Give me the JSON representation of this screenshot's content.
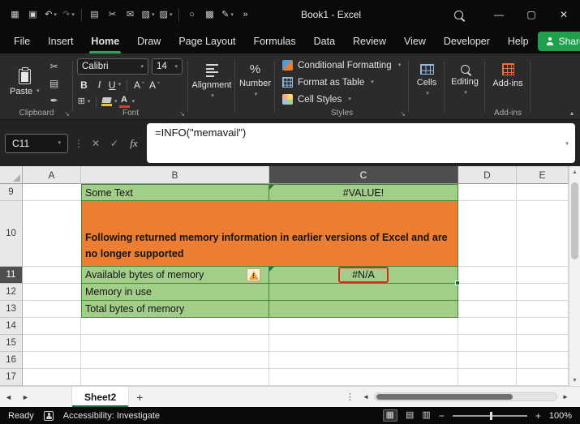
{
  "icons": {
    "customize": "▦",
    "save": "▣",
    "undo": "↶",
    "redo": "↷",
    "book": "▤",
    "cut": "✂",
    "mail": "✉",
    "table": "▧",
    "paint": "▨",
    "touch": "○",
    "camera": "▩",
    "draw": "✎",
    "more": "»",
    "chevron_down": "▾",
    "chevron_up": "▴",
    "minimize": "—",
    "maximize": "▢",
    "close": "✕",
    "vdots": "⋮",
    "cancel": "✕",
    "check": "✓",
    "copy": "▤",
    "format_painter": "✒",
    "borders": "⊞",
    "percent": "%",
    "caret_up": "ˆ",
    "caret_down": "ˇ",
    "launcher": "↘",
    "scroll_up": "▲",
    "scroll_down": "▼",
    "prev": "◄",
    "next": "►",
    "plus": "+",
    "minus": "−",
    "view_normal": "▦",
    "view_layout": "▤",
    "view_break": "▥"
  },
  "titlebar": {
    "title": "Book1 - Excel"
  },
  "ribbon_tabs": [
    "File",
    "Insert",
    "Home",
    "Draw",
    "Page Layout",
    "Formulas",
    "Data",
    "Review",
    "View",
    "Developer",
    "Help"
  ],
  "share": {
    "label": "Share"
  },
  "ribbon": {
    "clipboard": {
      "group_label": "Clipboard",
      "paste_label": "Paste"
    },
    "font": {
      "group_label": "Font",
      "family": "Calibri",
      "size": "14",
      "bold": "B",
      "italic": "I",
      "underline": "U",
      "letter": "A"
    },
    "alignment": {
      "label": "Alignment"
    },
    "number": {
      "label": "Number"
    },
    "styles": {
      "group_label": "Styles",
      "items": [
        "Conditional Formatting",
        "Format as Table",
        "Cell Styles"
      ]
    },
    "cells": {
      "label": "Cells"
    },
    "editing": {
      "label": "Editing"
    },
    "addins": {
      "label": "Add-ins",
      "group_label": "Add-ins"
    }
  },
  "formula_bar": {
    "name_box": "C11",
    "fx": "fx",
    "formula": "=INFO(\"memavail\")"
  },
  "grid": {
    "column_headers": [
      "A",
      "B",
      "C",
      "D",
      "E"
    ],
    "row_headers": [
      "9",
      "10",
      "11",
      "12",
      "13",
      "14",
      "15",
      "16",
      "17"
    ],
    "selected_cell": "C11",
    "warning_mark": "!",
    "cells": {
      "b9": "Some Text",
      "c9": "#VALUE!",
      "b10_merged": "Following returned memory information in earlier versions of Excel and are no longer supported",
      "b11": "Available bytes of memory",
      "c11": "#N/A",
      "b12": "Memory in use",
      "b13": "Total bytes of memory"
    },
    "colors": {
      "green_fill": "#A3CE89",
      "green_border": "#3E8A35",
      "orange_fill": "#ED7D31",
      "annotation_red": "#D92B1C",
      "selection_green": "#0E6E38"
    }
  },
  "sheet_bar": {
    "active_tab": "Sheet2"
  },
  "status_bar": {
    "mode": "Ready",
    "accessibility": "Accessibility: Investigate",
    "zoom": "100%"
  }
}
